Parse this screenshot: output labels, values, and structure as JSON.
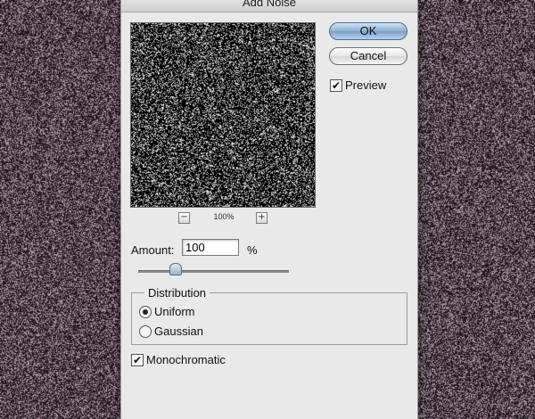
{
  "background": {
    "noise_tint": "#c7a9bf",
    "base_color": "#3a2a33"
  },
  "dialog": {
    "title": "Add Noise",
    "zoom": {
      "minus_glyph": "−",
      "level": "100%",
      "plus_glyph": "+"
    },
    "buttons": {
      "ok": "OK",
      "cancel": "Cancel"
    },
    "preview_checkbox": {
      "label": "Preview",
      "checked": true,
      "glyph": "✔"
    },
    "amount": {
      "label": "Amount:",
      "value": "100",
      "unit": "%",
      "slider_fraction": 0.25
    },
    "distribution": {
      "title": "Distribution",
      "options": [
        {
          "label": "Uniform",
          "selected": true
        },
        {
          "label": "Gaussian",
          "selected": false
        }
      ]
    },
    "monochromatic_checkbox": {
      "label": "Monochromatic",
      "checked": true,
      "glyph": "✔"
    }
  }
}
